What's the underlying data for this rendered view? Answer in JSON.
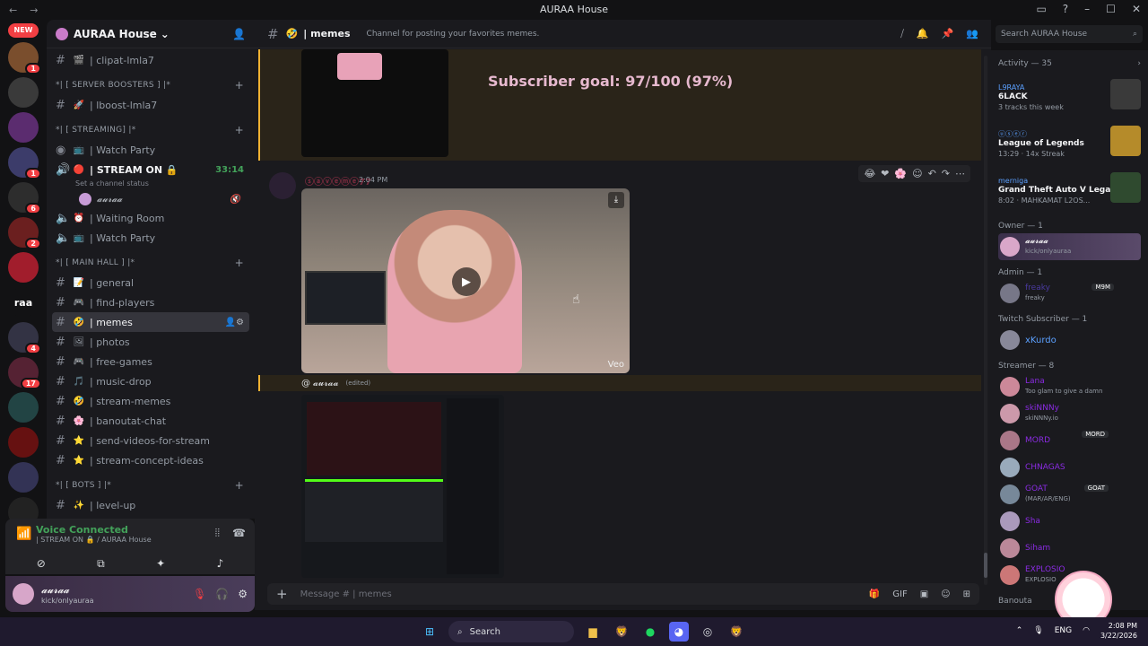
{
  "window": {
    "title": "AURAA House"
  },
  "guilds": {
    "new_badge": "NEW",
    "items": [
      {
        "color": "#7a4e2d",
        "ping": "1"
      },
      {
        "color": "#3a3a3a",
        "ping": ""
      },
      {
        "color": "#5b2c6f",
        "ping": ""
      },
      {
        "color": "#3c3c6a",
        "ping": "1"
      },
      {
        "color": "#2d2d2d",
        "ping": "6"
      },
      {
        "color": "#6b1f1f",
        "ping": "2"
      },
      {
        "color": "#a11d2c",
        "ping": ""
      },
      {
        "label": "raa",
        "color": "#121214",
        "ping": ""
      },
      {
        "color": "#334",
        "ping": "4"
      },
      {
        "color": "#523",
        "ping": "17"
      },
      {
        "color": "#244",
        "ping": ""
      },
      {
        "color": "#611",
        "ping": ""
      },
      {
        "color": "#335",
        "ping": ""
      },
      {
        "color": "#222",
        "ping": ""
      },
      {
        "color": "#511",
        "ping": ""
      }
    ]
  },
  "server": {
    "name": "AURAA House"
  },
  "channels": {
    "c1": "| clipat-lmla7",
    "cat_boosters": "*| [ SERVER BOOSTERS ] |*",
    "c2": "| lboost-lmla7",
    "cat_streaming": "*| [ STREAMING] |*",
    "c3": "| Watch Party",
    "c4": "| STREAM ON 🔒",
    "c4_time": "33:14",
    "c4_status": "Set a channel status",
    "voice_user": "𝓪𝓾𝓻𝓪𝓪",
    "c5": "| Waiting Room",
    "c6": "| Watch Party",
    "cat_main": "*| [ MAIN HALL ] |*",
    "c7": "| general",
    "c8": "| find-players",
    "c9": "| memes",
    "c10": "| photos",
    "c11": "| free-games",
    "c12": "| music-drop",
    "c13": "| stream-memes",
    "c14": "| banoutat-chat",
    "c15": "| send-videos-for-stream",
    "c16": "| stream-concept-ideas",
    "cat_bots": "*| [ BOTS ] |*",
    "c17": "| level-up"
  },
  "voice": {
    "title": "Voice Connected",
    "sub": "| STREAM ON 🔒 / AURAA House"
  },
  "user": {
    "name": "𝓪𝓾𝓻𝓪𝓪",
    "status": "kick/onlyauraa"
  },
  "header": {
    "channel": "| memes",
    "topic": "Channel for posting your favorites memes.",
    "search": "Search AURAA House"
  },
  "messages": {
    "goal": "Subscriber goal: 97/100 (97%)",
    "author": "ⓢⓐⓥⓔⓜⓔ77",
    "time": "2:04 PM",
    "veo": "Veo",
    "reply_user": "@ 𝓪𝓾𝓻𝓪𝓪",
    "edited": "(edited)"
  },
  "composer": {
    "placeholder": "Message # | memes"
  },
  "members": {
    "activity_title": "Activity — 35",
    "activities": [
      {
        "user": "L9RAYA",
        "title": "6LACK",
        "detail": "3 tracks this week",
        "color": "#3a3a3a"
      },
      {
        "user": "ⓤⓢⓔⓡ",
        "title": "League of Legends",
        "detail": "13:29 · 14x Streak",
        "color": "#b58b2a"
      },
      {
        "user": "merniga",
        "title": "Grand Theft Auto V Legacy",
        "detail": "8:02 · MAHKAMAT L2OS...",
        "color": "#2f4a2f"
      }
    ],
    "owner_role": "Owner — 1",
    "owner": {
      "name": "𝓪𝓾𝓻𝓪𝓪",
      "status": "kick/onlyauraa"
    },
    "admin_role": "Admin — 1",
    "admin": {
      "name": "freaky",
      "tag": "M9M",
      "status": "freaky"
    },
    "twitch_role": "Twitch Subscriber — 1",
    "twitch": {
      "name": "xKurdo"
    },
    "streamer_role": "Streamer — 8",
    "streamers": [
      {
        "name": "Lana",
        "status": "Too glam to give a damn",
        "color": "#c89"
      },
      {
        "name": "skiNNNy",
        "status": "skiNNNy.io",
        "color": "#c9a"
      },
      {
        "name": "MORD",
        "status": "",
        "tag": "MORD",
        "color": "#a78"
      },
      {
        "name": "CHNAGAS",
        "status": "",
        "color": "#9ab"
      },
      {
        "name": "GOAT",
        "status": "(MAR/AR/ENG)",
        "tag": "GOAT",
        "color": "#789"
      },
      {
        "name": "Sha",
        "status": "",
        "color": "#a9b"
      },
      {
        "name": "Siham",
        "status": "",
        "color": "#b89"
      },
      {
        "name": "EXPLOSIO",
        "status": "EXPLOSIO",
        "color": "#c77"
      }
    ],
    "next_role": "Banouta"
  },
  "taskbar": {
    "search": "Search",
    "lang": "ENG",
    "time": "2:08 PM",
    "date": "3/22/2026"
  }
}
